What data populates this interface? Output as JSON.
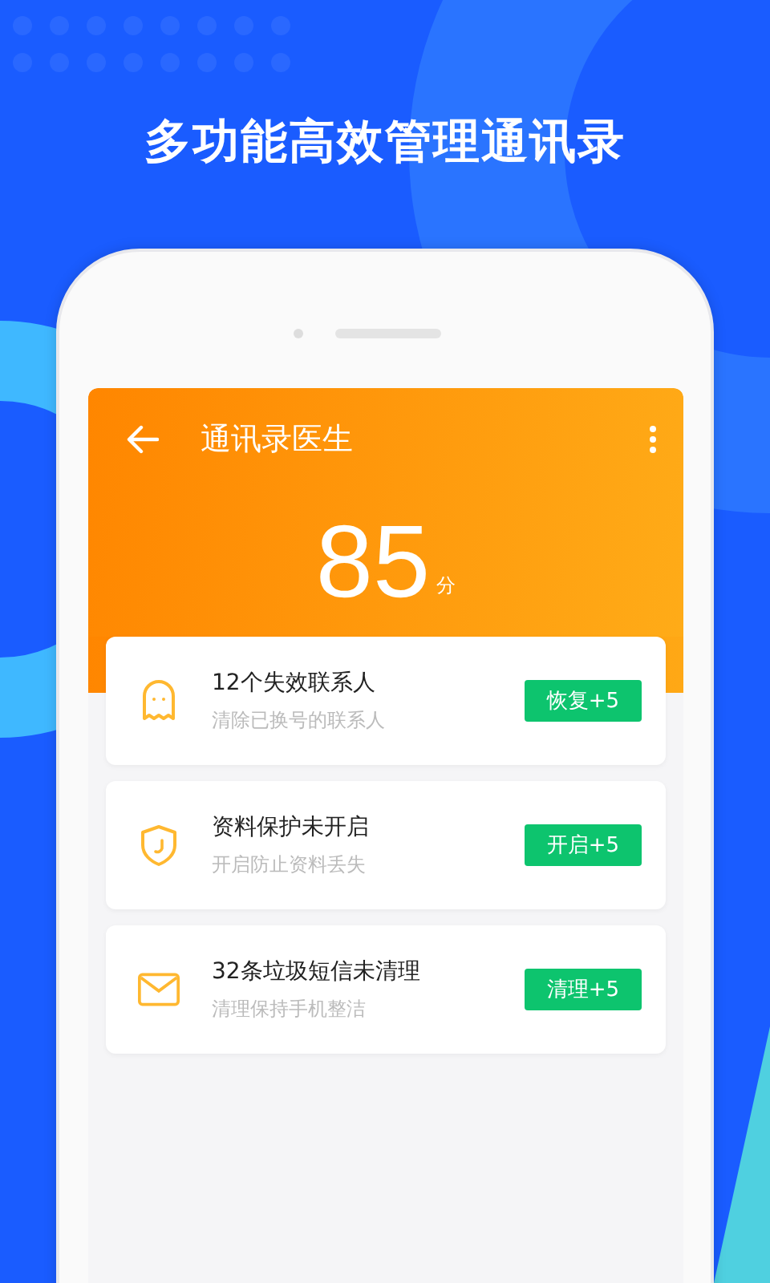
{
  "headline": "多功能高效管理通讯录",
  "app_bar": {
    "title": "通讯录医生"
  },
  "score": {
    "value": "85",
    "unit": "分"
  },
  "issues": [
    {
      "kind": "ghost",
      "title": "12个失效联系人",
      "subtitle": "清除已换号的联系人",
      "action": "恢复+5"
    },
    {
      "kind": "shield",
      "title": "资料保护未开启",
      "subtitle": "开启防止资料丢失",
      "action": "开启+5"
    },
    {
      "kind": "mail",
      "title": "32条垃圾短信未清理",
      "subtitle": "清理保持手机整洁",
      "action": "清理+5"
    }
  ]
}
